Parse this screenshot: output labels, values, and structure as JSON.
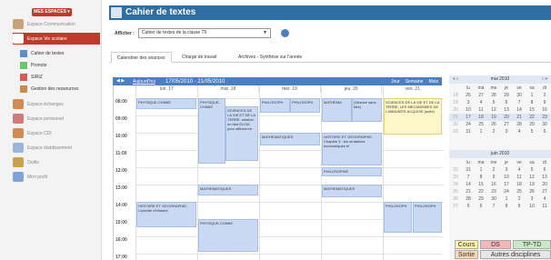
{
  "sidebar": {
    "menu_button": "MES ESPACES ▾",
    "items": [
      {
        "label": "Espace Communication",
        "color": "#c7a27a"
      },
      {
        "label": "Espace Vie scolaire",
        "color": "#c0392b",
        "active": true
      },
      {
        "label": "Espace échanges",
        "color": "#d08a52"
      },
      {
        "label": "Espace personnel",
        "color": "#d07a7a"
      },
      {
        "label": "Espace CDI",
        "color": "#d08a52"
      },
      {
        "label": "Espace établissement",
        "color": "#9bb4d9"
      },
      {
        "label": "Outils",
        "color": "#c9a14a"
      },
      {
        "label": "Mon profil",
        "color": "#7fa3d9"
      }
    ],
    "sub_items": [
      {
        "label": "Cahier de textes",
        "color": "#5b8fd0"
      },
      {
        "label": "Pronote",
        "color": "#6cc46c"
      },
      {
        "label": "SIRIZ",
        "color": "#d85a5a"
      },
      {
        "label": "Gestion des ressources",
        "color": "#c98b4a"
      }
    ]
  },
  "header": {
    "title": "Cahier de textes"
  },
  "afficher": {
    "label": "Afficher :",
    "value": "Cahier de textes de la classe T5"
  },
  "tabs": [
    "Calendrier des séances",
    "Charge de travail",
    "Archives - Synthèse sur l'année"
  ],
  "calendar": {
    "nav": "◀ ▶",
    "today": "Aujourd'hui",
    "range": "17/05/2010 - 21/05/2010",
    "views": [
      "Jour",
      "Semaine",
      "Mois"
    ],
    "days": [
      "lun. 17",
      "mar. 18",
      "mer. 19",
      "jeu. 20",
      "ven. 21"
    ],
    "times": [
      "08:00",
      "09:00",
      "10:00",
      "11:00",
      "12:00",
      "13:00",
      "14:00",
      "15:00",
      "16:00",
      "17:00"
    ],
    "events": [
      {
        "text": "PHYSIQUE-CHIMIE"
      },
      {
        "text": "PHYSIQUE-CHIMIE"
      },
      {
        "text": "SCIENCES DE LA VIE ET DE LA TERRE, relation en tant ELISA pour affiner/ure"
      },
      {
        "text": "PHILOSOPH"
      },
      {
        "text": "PHILOSOPH"
      },
      {
        "text": "MATHEMA"
      },
      {
        "text": "(Séance sans titre)"
      },
      {
        "text": "SCIENCES DE LA VIE ET DE LA TERRE, LES MECANISMES DE L'IMMUNITE ACQUISE (suite)",
        "yellow": true
      },
      {
        "text": "MATHEMATIQUES"
      },
      {
        "text": "HISTOIRE ET GEOGRAPHIE, Chapitre 3 : les mutations économiques et"
      },
      {
        "text": "PHILOSOPHIE"
      },
      {
        "text": "MATHEMATIQUES"
      },
      {
        "text": "MATHEMATIQUES"
      },
      {
        "text": "HISTOIRE ET GEOGRAPHIE, Contrôle d'Histoire"
      },
      {
        "text": "PHYSIQUE-CHIMIE"
      },
      {
        "text": "PHILOSOPH"
      },
      {
        "text": "PHILOSOPH"
      }
    ]
  },
  "mini_cal_1": {
    "title": "mai 2010",
    "nav_left": "«  ‹",
    "nav_right": "›  »",
    "weekdays": [
      "lu",
      "ma",
      "me",
      "je",
      "ve",
      "sa",
      "di"
    ],
    "rows": [
      {
        "wk": "18",
        "days": [
          "26",
          "27",
          "28",
          "29",
          "30",
          "1",
          "2"
        ]
      },
      {
        "wk": "19",
        "days": [
          "3",
          "4",
          "5",
          "6",
          "7",
          "8",
          "9"
        ]
      },
      {
        "wk": "20",
        "days": [
          "10",
          "11",
          "12",
          "13",
          "14",
          "15",
          "16"
        ]
      },
      {
        "wk": "21",
        "days": [
          "17",
          "18",
          "19",
          "20",
          "21",
          "22",
          "23"
        ]
      },
      {
        "wk": "22",
        "days": [
          "24",
          "25",
          "26",
          "27",
          "28",
          "29",
          "30"
        ]
      },
      {
        "wk": "23",
        "days": [
          "31",
          "1",
          "2",
          "3",
          "4",
          "5",
          "6"
        ]
      }
    ]
  },
  "mini_cal_2": {
    "title": "juin 2010",
    "weekdays": [
      "lu",
      "ma",
      "me",
      "je",
      "ve",
      "sa",
      "di"
    ],
    "rows": [
      {
        "wk": "22",
        "days": [
          "31",
          "1",
          "2",
          "3",
          "4",
          "5",
          "6"
        ]
      },
      {
        "wk": "23",
        "days": [
          "7",
          "8",
          "9",
          "10",
          "11",
          "12",
          "13"
        ]
      },
      {
        "wk": "24",
        "days": [
          "14",
          "15",
          "16",
          "17",
          "18",
          "19",
          "20"
        ]
      },
      {
        "wk": "25",
        "days": [
          "21",
          "22",
          "23",
          "24",
          "25",
          "26",
          "27"
        ]
      },
      {
        "wk": "26",
        "days": [
          "28",
          "29",
          "30",
          "1",
          "2",
          "3",
          "4"
        ]
      },
      {
        "wk": "27",
        "days": [
          "5",
          "6",
          "7",
          "8",
          "9",
          "10",
          "11"
        ]
      }
    ]
  },
  "legend": [
    "Cours",
    "DS",
    "TP-TD",
    "Sortie",
    "Autres disciplines"
  ]
}
